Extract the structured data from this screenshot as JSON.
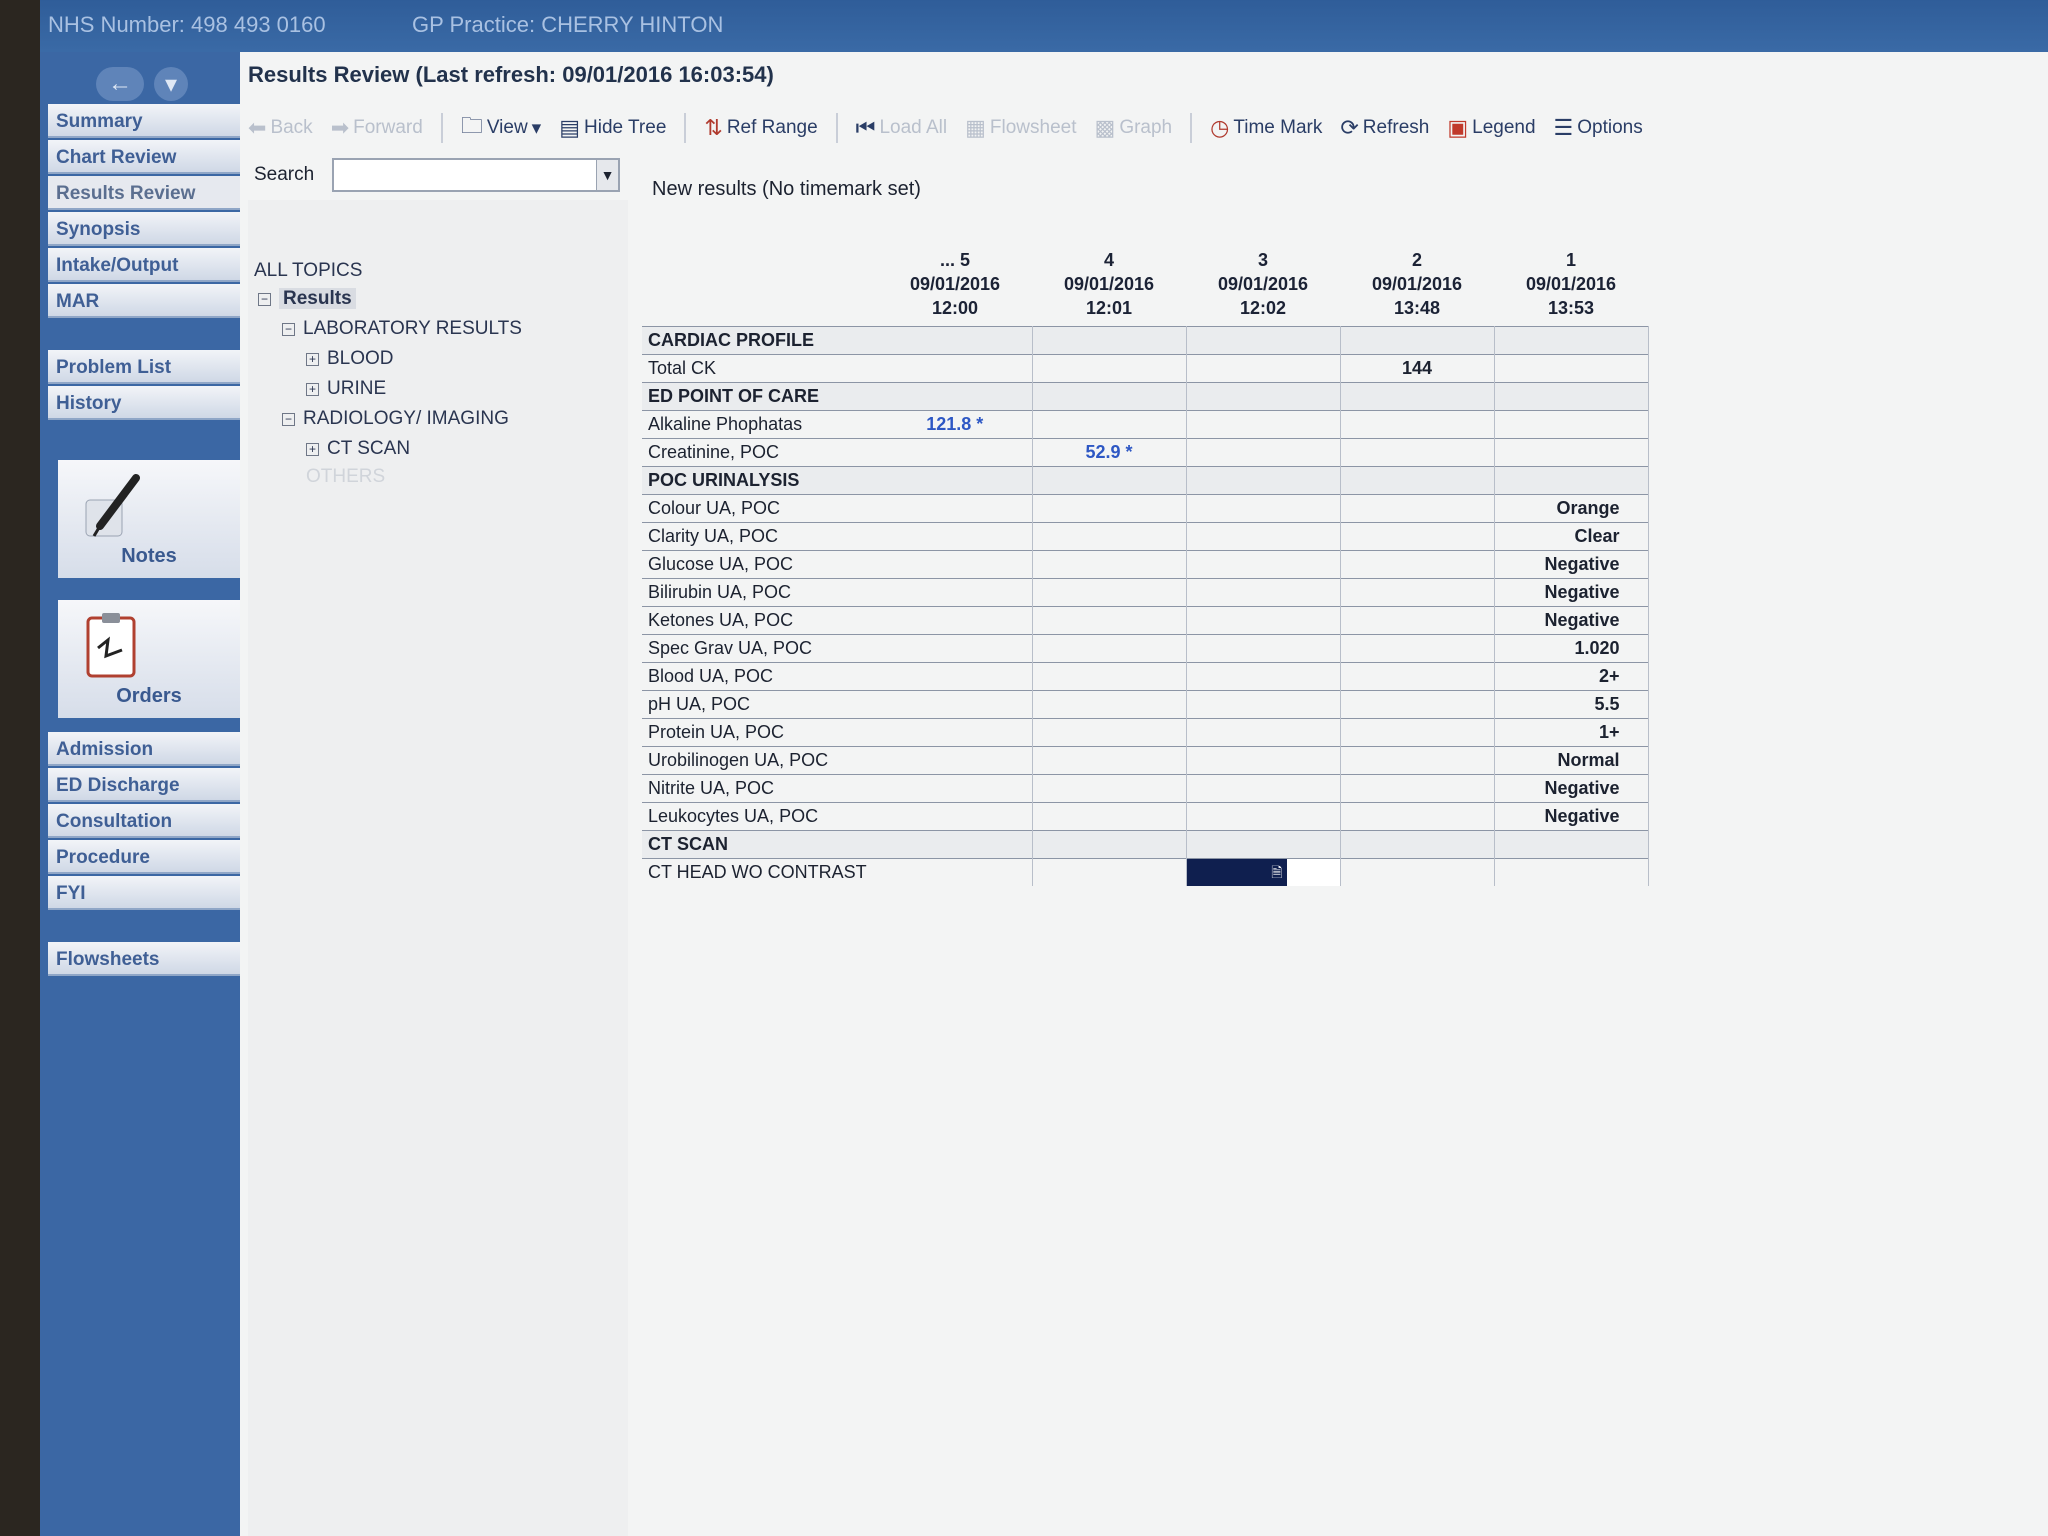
{
  "banner": {
    "nhs_number": "NHS Number: 498 493 0160",
    "gp_practice": "GP Practice: CHERRY HINTON"
  },
  "nav": {
    "items_top": [
      "Summary",
      "Chart Review",
      "Results Review",
      "Synopsis",
      "Intake/Output",
      "MAR"
    ],
    "items_mid": [
      "Problem List",
      "History"
    ],
    "notes_label": "Notes",
    "orders_label": "Orders",
    "items_bottom": [
      "Admission",
      "ED Discharge",
      "Consultation",
      "Procedure",
      "FYI"
    ],
    "flowsheets": "Flowsheets"
  },
  "window": {
    "title": "Results Review (Last refresh: 09/01/2016 16:03:54)"
  },
  "toolbar": {
    "back": "Back",
    "forward": "Forward",
    "view": "View",
    "hide_tree": "Hide Tree",
    "ref_range": "Ref Range",
    "load_all": "Load All",
    "flowsheet": "Flowsheet",
    "graph": "Graph",
    "time_mark": "Time Mark",
    "refresh": "Refresh",
    "legend": "Legend",
    "options": "Options"
  },
  "search": {
    "label": "Search",
    "value": ""
  },
  "tree": {
    "all_topics": "ALL TOPICS",
    "results": "Results",
    "laboratory": "LABORATORY RESULTS",
    "blood": "BLOOD",
    "urine": "URINE",
    "radiology": "RADIOLOGY/ IMAGING",
    "ct_scan": "CT SCAN",
    "others": "OTHERS"
  },
  "content": {
    "heading": "New results (No timemark set)"
  },
  "columns": [
    {
      "num": "... 5",
      "date": "09/01/2016",
      "time": "12:00"
    },
    {
      "num": "4",
      "date": "09/01/2016",
      "time": "12:01"
    },
    {
      "num": "3",
      "date": "09/01/2016",
      "time": "12:02"
    },
    {
      "num": "2",
      "date": "09/01/2016",
      "time": "13:48"
    },
    {
      "num": "1",
      "date": "09/01/2016",
      "time": "13:53"
    }
  ],
  "sections": {
    "cardiac": "CARDIAC PROFILE",
    "ed_poc": "ED POINT OF CARE",
    "poc_ua": "POC URINALYSIS",
    "ct_scan": "CT SCAN"
  },
  "rows": {
    "total_ck": {
      "label": "Total CK",
      "c2": "144"
    },
    "alk_phos": {
      "label": "Alkaline Phophatas",
      "c5": "121.8 *"
    },
    "creatinine": {
      "label": "Creatinine, POC",
      "c4": "52.9 *"
    },
    "colour": {
      "label": "Colour UA, POC",
      "c1": "Orange"
    },
    "clarity": {
      "label": "Clarity UA, POC",
      "c1": "Clear"
    },
    "glucose": {
      "label": "Glucose UA, POC",
      "c1": "Negative"
    },
    "bilirubin": {
      "label": "Bilirubin UA, POC",
      "c1": "Negative"
    },
    "ketones": {
      "label": "Ketones UA, POC",
      "c1": "Negative"
    },
    "spec_grav": {
      "label": "Spec Grav UA, POC",
      "c1": "1.020"
    },
    "blood": {
      "label": "Blood UA, POC",
      "c1": "2+"
    },
    "ph": {
      "label": "pH UA, POC",
      "c1": "5.5"
    },
    "protein": {
      "label": "Protein UA, POC",
      "c1": "1+"
    },
    "urobilinogen": {
      "label": "Urobilinogen UA, POC",
      "c1": "Normal"
    },
    "nitrite": {
      "label": "Nitrite UA, POC",
      "c1": "Negative"
    },
    "leukocytes": {
      "label": "Leukocytes UA, POC",
      "c1": "Negative"
    },
    "ct_head": {
      "label": "CT HEAD WO CONTRAST"
    }
  },
  "colors": {
    "nav_blue": "#3b67a4",
    "abnormal_value": "#2d57c4",
    "selected_cell": "#0f1f4f"
  }
}
